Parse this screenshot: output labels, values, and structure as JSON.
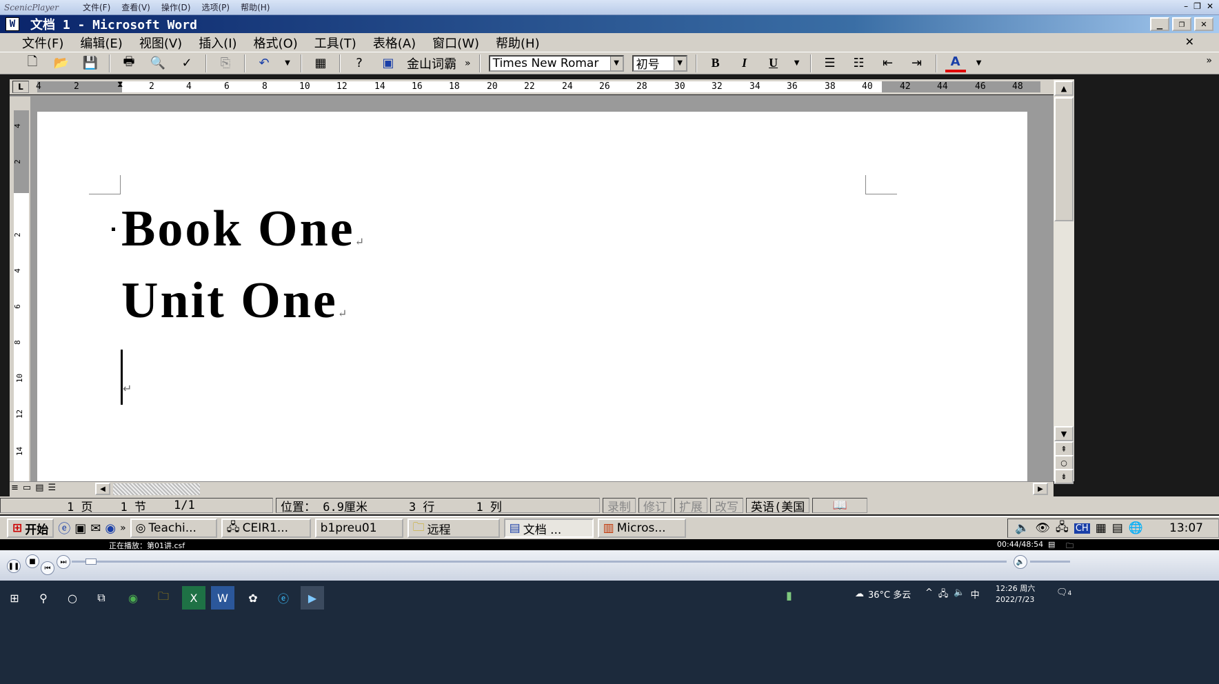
{
  "player": {
    "app_name": "ScenicPlayer",
    "menu": [
      "文件(F)",
      "查看(V)",
      "操作(D)",
      "选项(P)",
      "帮助(H)"
    ],
    "now_playing": "正在播放：第01讲.csf",
    "time": "00:44/48:54"
  },
  "window": {
    "title": "文档 1 - Microsoft Word"
  },
  "menubar": [
    "文件(F)",
    "编辑(E)",
    "视图(V)",
    "插入(I)",
    "格式(O)",
    "工具(T)",
    "表格(A)",
    "窗口(W)",
    "帮助(H)"
  ],
  "toolbar": {
    "kingsoft_label": "金山词霸",
    "font_name": "Times New Romar",
    "font_size": "初号",
    "bold": "B",
    "italic": "I",
    "underline": "U",
    "more": "»"
  },
  "ruler": {
    "numbers": [
      "4",
      "2",
      "2",
      "4",
      "6",
      "8",
      "10",
      "12",
      "14",
      "16",
      "18",
      "20",
      "22",
      "24",
      "26",
      "28",
      "30",
      "32",
      "34",
      "36",
      "38",
      "40",
      "42",
      "44",
      "46",
      "48"
    ],
    "vnumbers": [
      "4",
      "2",
      "2",
      "4",
      "6",
      "8",
      "10",
      "12",
      "14"
    ]
  },
  "document": {
    "line1": "Book One",
    "line2": "Unit One",
    "para_mark": "↵"
  },
  "statusbar": {
    "page": "1 页",
    "section": "1 节",
    "pages": "1/1",
    "position": "位置： 6.9厘米",
    "line": "3 行",
    "col": "1 列",
    "rec": "录制",
    "trk": "修订",
    "ext": "扩展",
    "ovr": "改写",
    "lang": "英语(美国"
  },
  "taskbar": {
    "start": "开始",
    "tasks": [
      "Teachi...",
      "CEIR1...",
      "b1preu01",
      "远程",
      "文档 ...",
      "Micros..."
    ],
    "clock": "13:07"
  },
  "win10": {
    "weather": "36°C 多云",
    "ime": "中",
    "time": "12:26 周六",
    "date": "2022/7/23",
    "notif": "4"
  }
}
